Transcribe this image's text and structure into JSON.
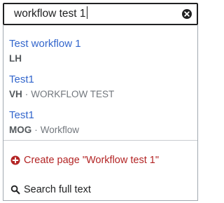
{
  "search": {
    "value": "workflow test 1",
    "clear_icon": "clear-icon"
  },
  "results": [
    {
      "title": "Test workflow 1",
      "namespace": "LH",
      "description": ""
    },
    {
      "title": "Test1",
      "namespace": "VH",
      "description": "WORKFLOW TEST"
    },
    {
      "title": "Test1",
      "namespace": "MOG",
      "description": "Workflow"
    }
  ],
  "separator": "·",
  "actions": {
    "create_label": "Create page \"Workflow test 1\"",
    "create_icon": "add-circle-icon",
    "fulltext_label": "Search full text",
    "fulltext_icon": "search-icon"
  },
  "colors": {
    "link": "#3366cc",
    "create": "#b32424",
    "text": "#202122",
    "muted": "#72777d"
  }
}
